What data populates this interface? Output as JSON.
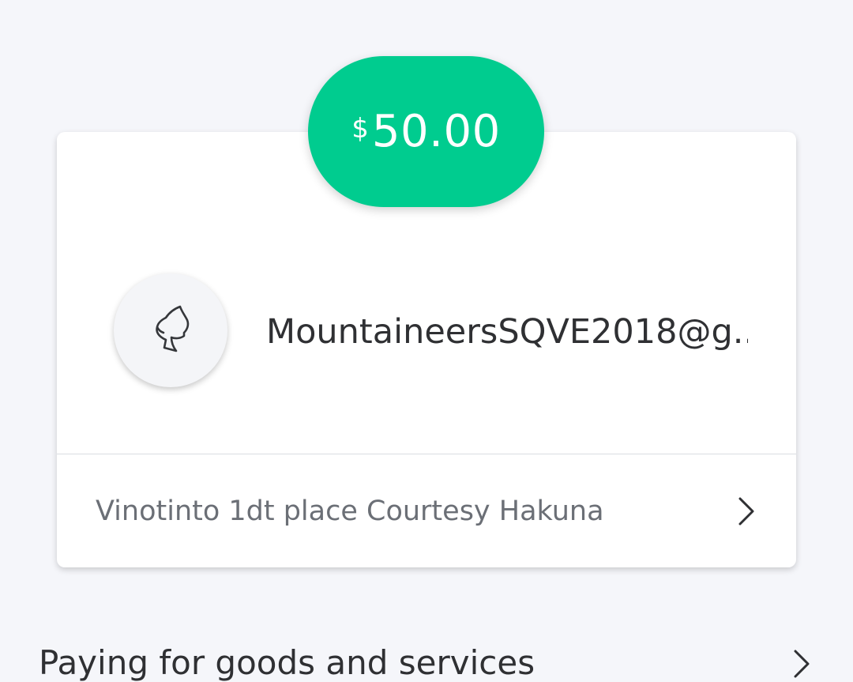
{
  "payment": {
    "currency_symbol": "$",
    "amount": "50.00",
    "accent_color": "#00cc8f"
  },
  "recipient": {
    "display": "MountaineersSQVE2018@g...",
    "avatar_icon": "profile-silhouette-icon"
  },
  "note": {
    "text": "Vinotinto 1dt place Courtesy Hakuna",
    "chevron_icon": "chevron-right-icon"
  },
  "section": {
    "title": "Paying for goods and services",
    "chevron_icon": "chevron-right-icon"
  }
}
